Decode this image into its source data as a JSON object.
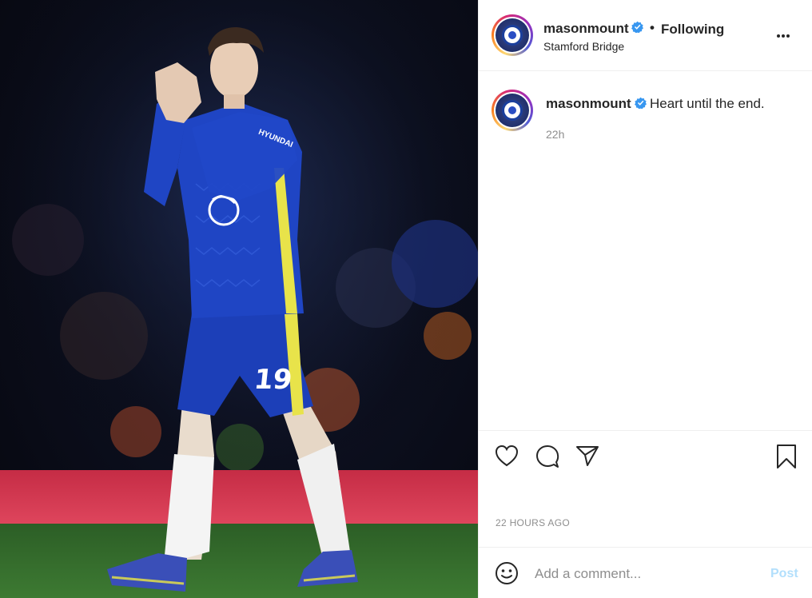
{
  "post": {
    "image_alt": "Player in blue kit applauding on the pitch"
  },
  "header": {
    "username": "masonmount",
    "separator": "•",
    "follow_label": "Following",
    "location": "Stamford Bridge"
  },
  "caption": {
    "username": "masonmount",
    "text": "Heart until the end.",
    "relative_time": "22h"
  },
  "actions": {
    "timestamp": "22 HOURS AGO"
  },
  "comment_bar": {
    "placeholder": "Add a comment...",
    "post_label": "Post"
  },
  "jersey": {
    "number": "19",
    "sponsor": "HYUNDAI"
  },
  "colors": {
    "verified": "#3897f0",
    "post_disabled": "#b2dffc",
    "kit_blue": "#1c3fb8",
    "kit_yellow": "#e8e34a",
    "pitch_green": "#2f6a2a",
    "ad_board": "#d8354f"
  },
  "icons": [
    "verified-icon",
    "more-icon",
    "heart-icon",
    "comment-icon",
    "share-icon",
    "bookmark-icon",
    "emoji-icon"
  ]
}
